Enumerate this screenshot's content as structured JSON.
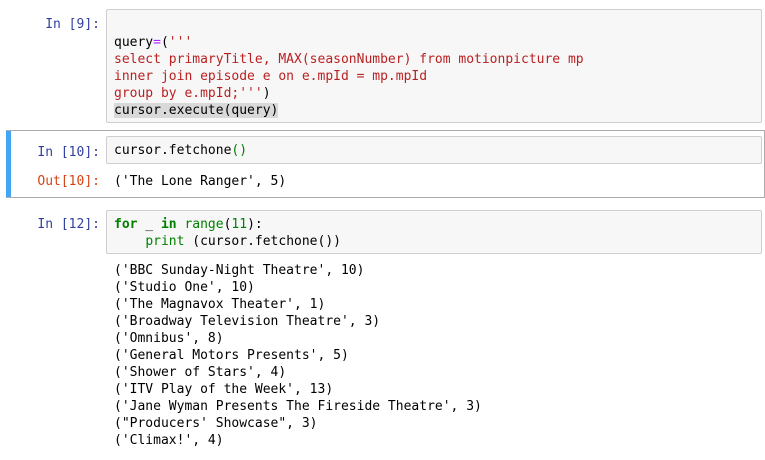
{
  "cells": [
    {
      "prompt": "In [9]:",
      "code_lines": [
        "query=('''",
        "select primaryTitle, MAX(seasonNumber) from motionpicture mp",
        "inner join episode e on e.mpId = mp.mpId",
        "group by e.mpId;''')",
        "cursor.execute(query)"
      ]
    },
    {
      "prompt": "In [10]:",
      "code_lines": [
        "cursor.fetchone()"
      ],
      "out_prompt": "Out[10]:",
      "output": "('The Lone Ranger', 5)"
    },
    {
      "prompt": "In [12]:",
      "code_lines": [
        "for _ in range(11):",
        "    print (cursor.fetchone())"
      ],
      "output_lines": [
        "('BBC Sunday-Night Theatre', 10)",
        "('Studio One', 10)",
        "('The Magnavox Theater', 1)",
        "('Broadway Television Theatre', 3)",
        "('Omnibus', 8)",
        "('General Motors Presents', 5)",
        "('Shower of Stars', 4)",
        "('ITV Play of the Week', 13)",
        "('Jane Wyman Presents The Fireside Theatre', 3)",
        "(\"Producers' Showcase\", 3)",
        "('Climax!', 4)"
      ]
    }
  ]
}
